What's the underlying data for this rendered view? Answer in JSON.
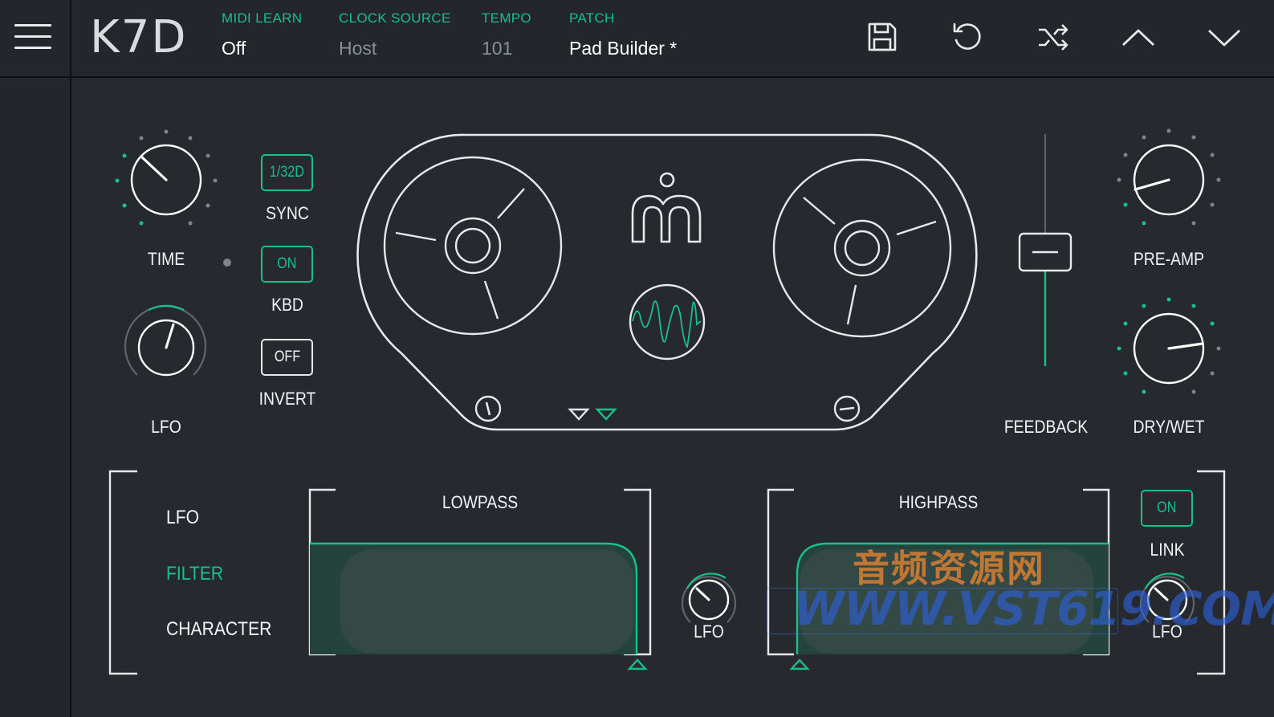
{
  "app": {
    "logo": "K7D"
  },
  "header": {
    "midi_learn": {
      "label": "MIDI LEARN",
      "value": "Off"
    },
    "clock_source": {
      "label": "CLOCK SOURCE",
      "value": "Host"
    },
    "tempo": {
      "label": "TEMPO",
      "value": "101"
    },
    "patch": {
      "label": "PATCH",
      "value": "Pad Builder *"
    }
  },
  "toolbar": {
    "icons": [
      "save-icon",
      "undo-icon",
      "shuffle-icon",
      "chevron-up-icon",
      "chevron-down-icon"
    ]
  },
  "controls": {
    "time_label": "TIME",
    "lfo_label": "LFO",
    "sync": {
      "value": "1/32D",
      "label": "SYNC"
    },
    "kbd": {
      "value": "ON",
      "label": "KBD"
    },
    "invert": {
      "value": "OFF",
      "label": "INVERT"
    },
    "feedback_label": "FEEDBACK",
    "pre_amp_label": "PRE-AMP",
    "dry_wet_label": "DRY/WET"
  },
  "bottom": {
    "menu": {
      "lfo": "LFO",
      "filter": "FILTER",
      "character": "CHARACTER"
    },
    "active_menu": "FILTER",
    "lowpass_label": "LOWPASS",
    "highpass_label": "HIGHPASS",
    "lfo_mid_label": "LFO",
    "link": {
      "value": "ON",
      "label": "LINK"
    },
    "lfo_right_label": "LFO"
  },
  "watermark": {
    "cn": "音频资源网",
    "url": "WWW.VST619.COM"
  },
  "colors": {
    "accent": "#18c08a",
    "background": "#262a2f",
    "panel": "#23272b",
    "line": "#e6e8ea"
  }
}
